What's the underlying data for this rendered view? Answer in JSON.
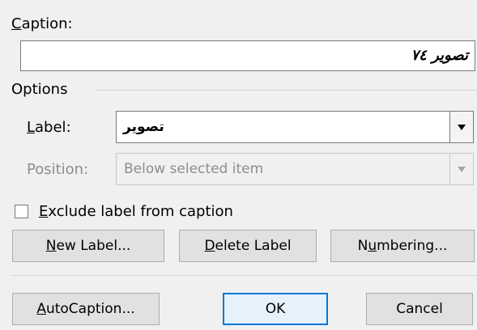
{
  "caption": {
    "label_accel": "C",
    "label_rest": "aption:",
    "value": "تصویر ٧٤"
  },
  "options": {
    "heading": "Options",
    "label_field": {
      "label_accel": "L",
      "label_rest": "abel:",
      "value": "تصویر"
    },
    "position_field": {
      "label": "Position:",
      "value": "Below selected item"
    },
    "exclude_checkbox": {
      "label_accel": "E",
      "label_rest": "xclude label from caption",
      "checked": false
    }
  },
  "buttons": {
    "new_label": {
      "accel": "N",
      "rest": "ew Label..."
    },
    "delete_label": {
      "accel": "D",
      "rest": "elete Label"
    },
    "numbering": {
      "pre": "N",
      "accel": "u",
      "rest": "mbering..."
    },
    "autocaption": {
      "accel": "A",
      "rest": "utoCaption..."
    },
    "ok": "OK",
    "cancel": "Cancel"
  },
  "icons": {
    "dropdown": "chevron-down-icon"
  },
  "colors": {
    "default_button_border": "#0078d7",
    "dialog_background": "#f0f0f0",
    "disabled_text": "#8d8d8d"
  }
}
